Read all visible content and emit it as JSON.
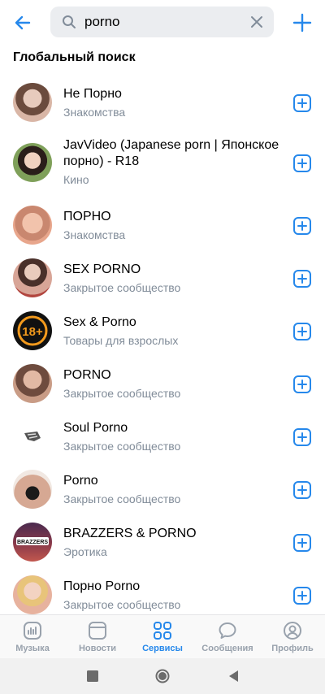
{
  "search": {
    "query": "porno"
  },
  "section_title": "Глобальный поиск",
  "results": [
    {
      "name": "Не Порно",
      "sub": "Знакомства",
      "avatar_color": "#c9a99a"
    },
    {
      "name": "JavVideo (Japanese porn | Японское порно) - R18",
      "sub": "Кино",
      "avatar_color": "#7a9a5c"
    },
    {
      "name": "ПОРНО",
      "sub": "Знакомства",
      "avatar_color": "#e0a184"
    },
    {
      "name": "SEX PORNO",
      "sub": "Закрытое сообщество",
      "avatar_color": "#b8867a"
    },
    {
      "name": "Sex & Porno",
      "sub": "Товары для взрослых",
      "avatar_color": "#111111"
    },
    {
      "name": "PORNO",
      "sub": "Закрытое сообщество",
      "avatar_color": "#a87d6c"
    },
    {
      "name": "Soul Porno",
      "sub": "Закрытое сообщество",
      "avatar_color": "#ffffff"
    },
    {
      "name": "Porno",
      "sub": "Закрытое сообщество",
      "avatar_color": "#c29383"
    },
    {
      "name": "BRAZZERS & PORNO",
      "sub": "Эротика",
      "avatar_color": "#6a2d3a"
    },
    {
      "name": "Порно Porno",
      "sub": "Закрытое сообщество",
      "avatar_color": "#e4b7a4"
    }
  ],
  "avatar_badge_18": "18+",
  "avatar_badge_brazzers": "BRAZZERS",
  "tabs": [
    {
      "label": "Музыка",
      "icon": "music-icon"
    },
    {
      "label": "Новости",
      "icon": "news-icon"
    },
    {
      "label": "Сервисы",
      "icon": "services-icon",
      "active": true
    },
    {
      "label": "Сообщения",
      "icon": "messages-icon"
    },
    {
      "label": "Профиль",
      "icon": "profile-icon"
    }
  ],
  "colors": {
    "accent": "#2688eb",
    "secondary_text": "#818c99",
    "search_bg": "#ebedf0"
  }
}
